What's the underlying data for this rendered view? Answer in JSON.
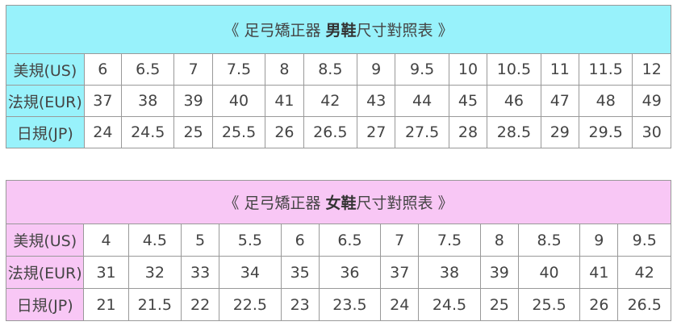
{
  "men_table": {
    "title_prefix": "《 足弓矯正器 ",
    "title_bold": "男鞋",
    "title_suffix": "尺寸對照表 》",
    "accent_color": "#98f2fb",
    "rows": [
      {
        "label": "美規(US)",
        "values": [
          "6",
          "6.5",
          "7",
          "7.5",
          "8",
          "8.5",
          "9",
          "9.5",
          "10",
          "10.5",
          "11",
          "11.5",
          "12"
        ]
      },
      {
        "label": "法規(EUR)",
        "values": [
          "37",
          "38",
          "39",
          "40",
          "41",
          "42",
          "43",
          "44",
          "45",
          "46",
          "47",
          "48",
          "49"
        ]
      },
      {
        "label": "日規(JP)",
        "values": [
          "24",
          "24.5",
          "25",
          "25.5",
          "26",
          "26.5",
          "27",
          "27.5",
          "28",
          "28.5",
          "29",
          "29.5",
          "30"
        ]
      }
    ]
  },
  "women_table": {
    "title_prefix": "《 足弓矯正器 ",
    "title_bold": "女鞋",
    "title_suffix": "尺寸對照表 》",
    "accent_color": "#f8c7f5",
    "rows": [
      {
        "label": "美規(US)",
        "values": [
          "4",
          "4.5",
          "5",
          "5.5",
          "6",
          "6.5",
          "7",
          "7.5",
          "8",
          "8.5",
          "9",
          "9.5"
        ]
      },
      {
        "label": "法規(EUR)",
        "values": [
          "31",
          "32",
          "33",
          "34",
          "35",
          "36",
          "37",
          "38",
          "39",
          "40",
          "41",
          "42"
        ]
      },
      {
        "label": "日規(JP)",
        "values": [
          "21",
          "21.5",
          "22",
          "22.5",
          "23",
          "23.5",
          "24",
          "24.5",
          "25",
          "25.5",
          "26",
          "26.5"
        ]
      }
    ]
  }
}
